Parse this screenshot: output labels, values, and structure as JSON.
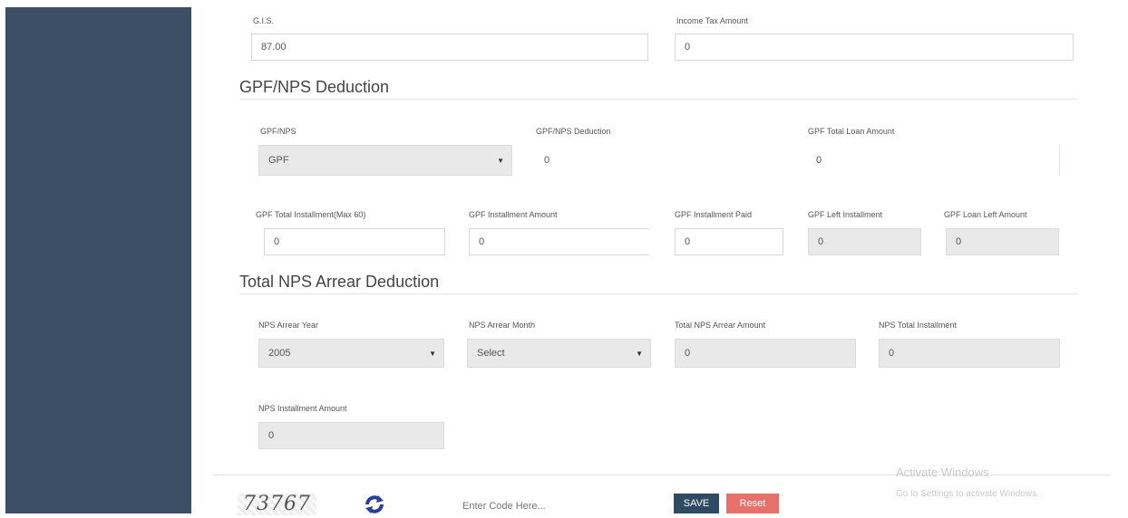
{
  "top_row": {
    "gis": {
      "label": "G.I.S.",
      "value": "87.00"
    },
    "income_tax": {
      "label": "Income Tax Amount",
      "value": "0"
    }
  },
  "gpf_section": {
    "heading": "GPF/NPS Deduction",
    "gpf_nps": {
      "label": "GPF/NPS",
      "value": "GPF"
    },
    "gpf_nps_deduction": {
      "label": "GPF/NPS Deduction",
      "value": "0"
    },
    "gpf_total_loan": {
      "label": "GPF Total Loan Amount",
      "value": "0"
    },
    "gpf_total_installment": {
      "label": "GPF Total Installment(Max 60)",
      "value": "0"
    },
    "gpf_installment_amount": {
      "label": "GPF Installment Amount",
      "value": "0"
    },
    "gpf_installment_paid": {
      "label": "GPF Installment Paid",
      "value": "0"
    },
    "gpf_left_installment": {
      "label": "GPF Left Installment",
      "value": "0"
    },
    "gpf_loan_left_amount": {
      "label": "GPF Loan Left Amount",
      "value": "0"
    }
  },
  "nps_section": {
    "heading": "Total NPS Arrear Deduction",
    "nps_arrear_year": {
      "label": "NPS Arrear Year",
      "value": "2005"
    },
    "nps_arrear_month": {
      "label": "NPS Arrear Month",
      "value": "Select"
    },
    "total_nps_arrear_amount": {
      "label": "Total NPS Arrear Amount",
      "value": "0"
    },
    "nps_total_installment": {
      "label": "NPS Total Installment",
      "value": "0"
    },
    "nps_installment_amount": {
      "label": "NPS Installment Amount",
      "value": "0"
    }
  },
  "footer": {
    "captcha_text": "73767",
    "code_placeholder": "Enter Code Here...",
    "save_label": "SAVE",
    "reset_label": "Reset"
  },
  "watermark": {
    "line1": "Activate Windows",
    "line2": "Go to Settings to activate Windows."
  },
  "colors": {
    "sidebar": "#3c4e63",
    "save": "#2f4a63",
    "reset": "#e8706a",
    "refresh": "#2a3f9a"
  }
}
